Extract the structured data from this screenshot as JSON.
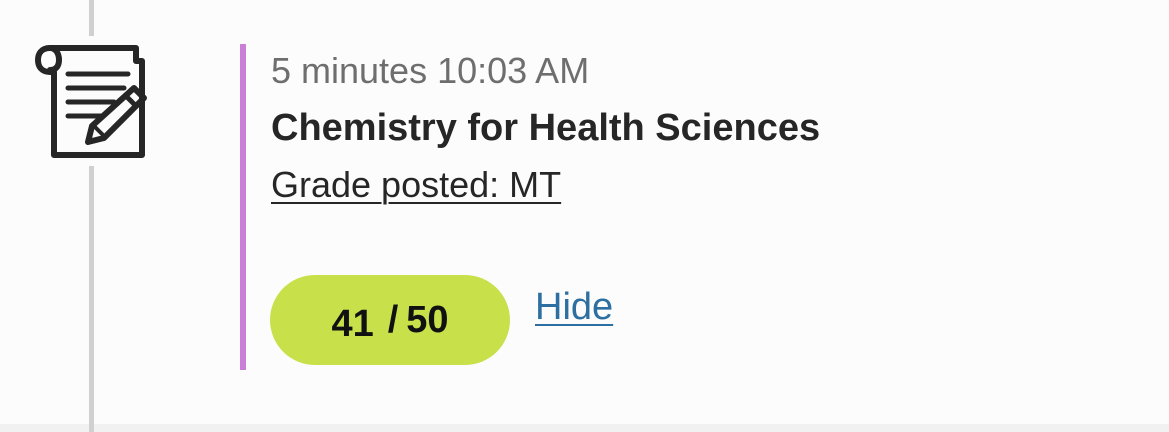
{
  "activity": {
    "time": "5 minutes 10:03 AM",
    "course_title": "Chemistry for Health Sciences",
    "grade_link": "Grade posted: MT",
    "score": {
      "earned": "41",
      "separator": "/",
      "possible": "50"
    },
    "hide_label": "Hide",
    "icon": "document-pencil-icon"
  },
  "colors": {
    "accent_bar": "#c97fd6",
    "score_pill": "#c8e04a",
    "link": "#2c6fa0",
    "timeline": "#d0d0d0"
  }
}
